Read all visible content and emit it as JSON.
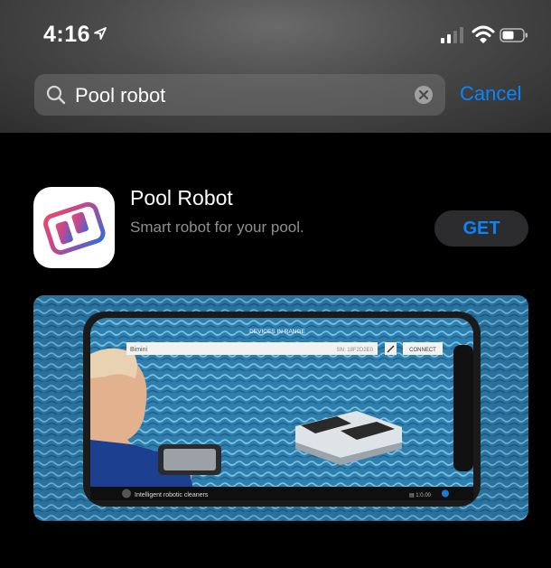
{
  "status_bar": {
    "time": "4:16",
    "icons": [
      "location-arrow-icon",
      "signal-icon",
      "wifi-icon",
      "battery-icon"
    ]
  },
  "search": {
    "query": "Pool robot",
    "cancel_label": "Cancel"
  },
  "result": {
    "app_name": "Pool Robot",
    "subtitle": "Smart robot for your pool.",
    "get_label": "GET"
  },
  "screenshot": {
    "heading": "DEVICES IN RANGE",
    "device_name": "Bimini",
    "serial": "SN: 18F2D2E0",
    "connect_label": "CONNECT",
    "footer_text": "Intelligent robotic cleaners",
    "footer_right": "▤ 1:0.00"
  },
  "colors": {
    "accent": "#0a84ff",
    "secondary_text": "#8e8e93",
    "get_bg": "#2c2c2e"
  }
}
